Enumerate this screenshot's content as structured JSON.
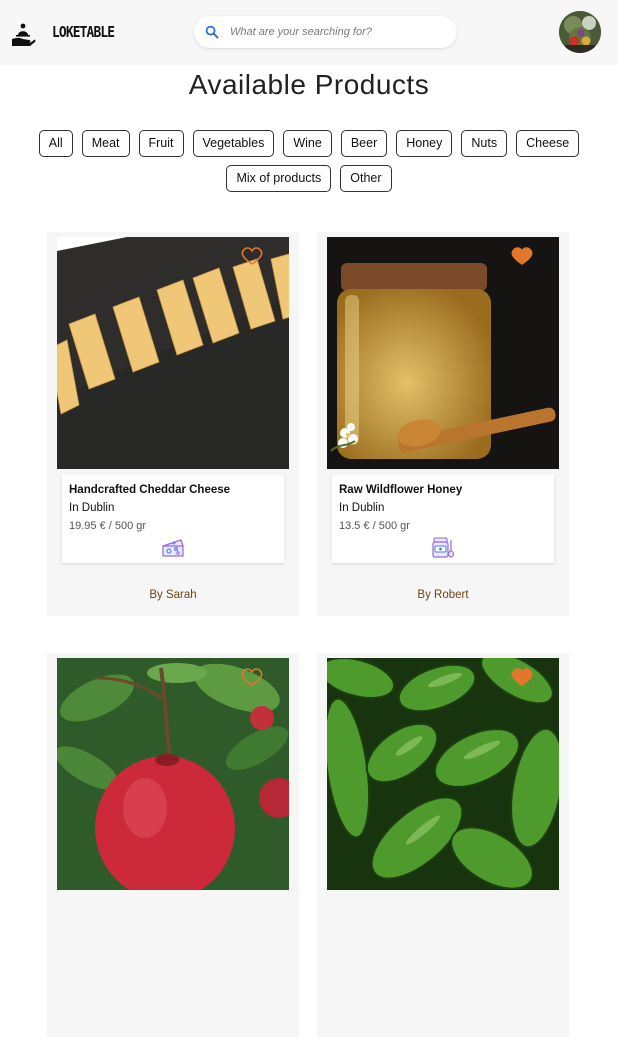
{
  "header": {
    "brand": "LOKETABLE",
    "search": {
      "placeholder": "What are your searching for?",
      "value": ""
    }
  },
  "page_title": "Available Products",
  "filters": [
    "All",
    "Meat",
    "Fruit",
    "Vegetables",
    "Wine",
    "Beer",
    "Honey",
    "Nuts",
    "Cheese",
    "Mix of products",
    "Other"
  ],
  "products": [
    {
      "name": "Handcrafted Cheddar Cheese",
      "location": "In Dublin",
      "price": "19.95 € / 500 gr",
      "seller": "By Sarah",
      "favorited": false,
      "category_icon": "cheese-icon",
      "image": "cheese-sticks-photo"
    },
    {
      "name": "Raw Wildflower Honey",
      "location": "In Dublin",
      "price": "13.5 € / 500 gr",
      "seller": "By Robert",
      "favorited": true,
      "category_icon": "honey-jar-icon",
      "image": "honey-jar-photo"
    },
    {
      "favorited": false,
      "image": "red-apple-photo"
    },
    {
      "favorited": true,
      "image": "cucumbers-photo"
    }
  ],
  "colors": {
    "heart": "#e2772b",
    "seller_text": "#6a4618",
    "category_icon_purple": "#8e6bdc",
    "category_icon_blue": "#3f80e0",
    "search_icon": "#2f6fe0"
  }
}
